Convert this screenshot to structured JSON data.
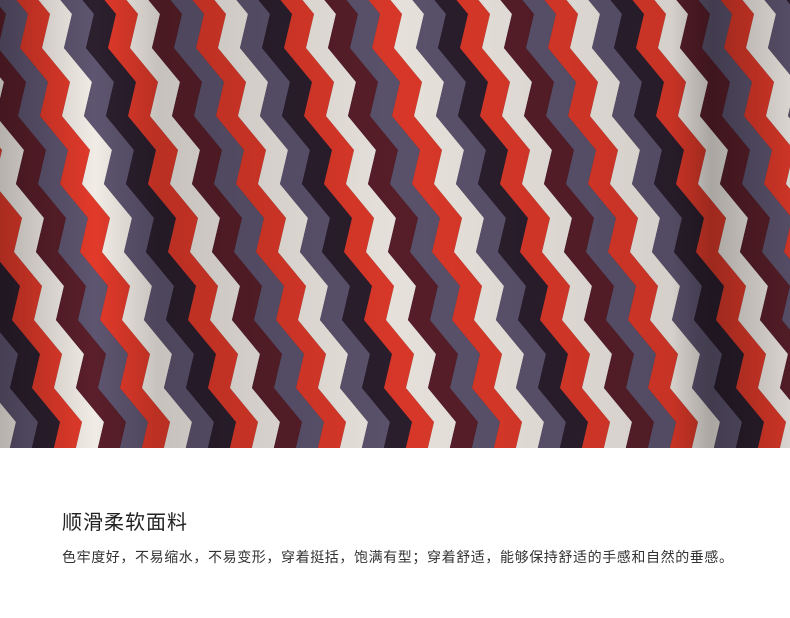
{
  "photo": {
    "subject": "fabric-closeup",
    "palette": {
      "red": "#e23a2a",
      "white": "#f2ece6",
      "purple": "#5e5570",
      "dark": "#2c1f2e",
      "maroon": "#5a1f2a"
    }
  },
  "text": {
    "heading": "顺滑柔软面料",
    "description": "色牢度好，不易缩水，不易变形，穿着挺括，饱满有型；穿着舒适，能够保持舒适的手感和自然的垂感。"
  }
}
